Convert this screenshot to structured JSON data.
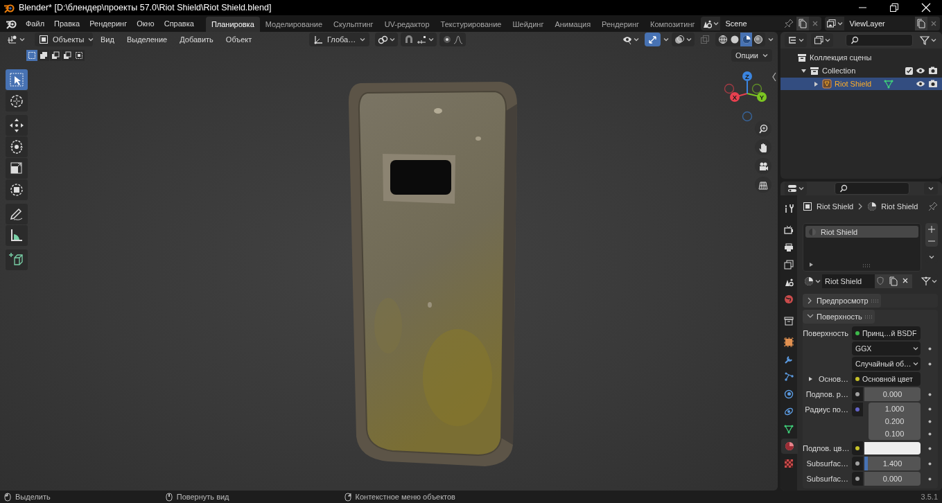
{
  "window": {
    "title": "Blender* [D:\\блендер\\проекты 57.0\\Riot Shield\\Riot Shield.blend]"
  },
  "menu": [
    "Файл",
    "Правка",
    "Рендеринг",
    "Окно",
    "Справка"
  ],
  "workspaces": [
    {
      "label": "Планировка",
      "selected": true
    },
    {
      "label": "Моделирование",
      "selected": false
    },
    {
      "label": "Скульптинг",
      "selected": false
    },
    {
      "label": "UV-редактор",
      "selected": false
    },
    {
      "label": "Текстурирование",
      "selected": false
    },
    {
      "label": "Шейдинг",
      "selected": false
    },
    {
      "label": "Анимация",
      "selected": false
    },
    {
      "label": "Рендеринг",
      "selected": false
    },
    {
      "label": "Композитинг",
      "selected": false
    }
  ],
  "scene": {
    "name": "Scene"
  },
  "view_layer": {
    "name": "ViewLayer"
  },
  "viewport": {
    "mode": "Объекты",
    "menus": [
      "Вид",
      "Выделение",
      "Добавить",
      "Объект"
    ],
    "orientation": "Глоба…",
    "options": "Опции",
    "gizmos_on": true,
    "select_modes": [
      {
        "kind": "set",
        "selected": true
      },
      {
        "kind": "extend",
        "selected": false
      },
      {
        "kind": "subtract",
        "selected": false
      },
      {
        "kind": "difference",
        "selected": false
      },
      {
        "kind": "intersect",
        "selected": false
      }
    ],
    "shading": [
      {
        "kind": "wireframe",
        "selected": false
      },
      {
        "kind": "solid",
        "selected": false
      },
      {
        "kind": "material",
        "selected": true
      },
      {
        "kind": "rendered",
        "selected": false
      }
    ],
    "tools": [
      {
        "kind": "select",
        "selected": true
      },
      {
        "kind": "cursor",
        "selected": false
      },
      {
        "kind": "move",
        "selected": false
      },
      {
        "kind": "rotate",
        "selected": false
      },
      {
        "kind": "scale",
        "selected": false
      },
      {
        "kind": "transform",
        "selected": false
      },
      {
        "kind": "annotate",
        "selected": false
      },
      {
        "kind": "measure",
        "selected": false
      },
      {
        "kind": "add_cube",
        "selected": false
      }
    ],
    "gizmo": {
      "axes": [
        {
          "label": "X",
          "color": "#e8404f"
        },
        {
          "label": "Y",
          "color": "#7cc622"
        },
        {
          "label": "Z",
          "color": "#3b85e0"
        }
      ]
    }
  },
  "outliner": {
    "items": [
      {
        "kind": "scene_collection",
        "label": "Коллекция сцены",
        "children": [
          {
            "kind": "collection",
            "label": "Collection",
            "expanded": true,
            "checked": true,
            "selected": false,
            "children": [
              {
                "kind": "mesh_object",
                "label": "Riot Shield",
                "expanded": false,
                "selected": true
              }
            ]
          }
        ]
      }
    ]
  },
  "properties": {
    "tabs": [
      {
        "kind": "tool",
        "selected": false
      },
      {
        "kind": "render",
        "selected": false
      },
      {
        "kind": "output",
        "selected": false
      },
      {
        "kind": "view_layer",
        "selected": false
      },
      {
        "kind": "scene",
        "selected": false
      },
      {
        "kind": "world",
        "selected": false
      },
      {
        "kind": "collection",
        "selected": false
      },
      {
        "kind": "object",
        "selected": false
      },
      {
        "kind": "modifiers",
        "selected": false
      },
      {
        "kind": "particles",
        "selected": false
      },
      {
        "kind": "physics",
        "selected": false
      },
      {
        "kind": "constraints",
        "selected": false
      },
      {
        "kind": "data",
        "selected": false
      },
      {
        "kind": "material",
        "selected": true
      },
      {
        "kind": "texture",
        "selected": false
      }
    ],
    "breadcrumb": [
      "Riot Shield",
      "Riot Shield"
    ],
    "slots": [
      {
        "label": "Riot Shield",
        "selected": true
      }
    ],
    "material_name": "Riot Shield",
    "panels": [
      {
        "title": "Предпросмотр",
        "expanded": false
      },
      {
        "title": "Поверхность",
        "expanded": true
      }
    ],
    "fields": [
      {
        "kind": "link",
        "label": "Поверхность",
        "socket": {
          "color": "#3cb84a"
        },
        "value": "Принц…й BSDF"
      },
      {
        "kind": "dropdown",
        "value": "GGX"
      },
      {
        "kind": "dropdown",
        "value": "Случайный об…"
      },
      {
        "kind": "link",
        "label": "Основ…",
        "socket": {
          "color": "#c7c229"
        },
        "value": "Основной цвет"
      },
      {
        "kind": "number",
        "label": "Подпов. р…",
        "socket": {
          "color": "#a1a1a1"
        },
        "value": "0.000"
      },
      {
        "kind": "vector",
        "label": "Радиус по…",
        "socket": {
          "color": "#6363c7"
        },
        "values": [
          "1.000",
          "0.200",
          "0.100"
        ]
      },
      {
        "kind": "color",
        "label": "Подпов. цв…",
        "socket": {
          "color": "#c7c229"
        },
        "swatch": {
          "color": "#eeeeee"
        }
      },
      {
        "kind": "slider",
        "label": "Subsurfac…",
        "socket": {
          "color": "#a1a1a1"
        },
        "value": "1.400",
        "level": 0.06
      },
      {
        "kind": "number",
        "label": "Subsurfac…",
        "socket": {
          "color": "#a1a1a1"
        },
        "value": "0.000"
      }
    ]
  },
  "status_bar": {
    "hints": [
      "Выделить",
      "Повернуть вид",
      "Контекстное меню объектов"
    ],
    "version": "3.5.1"
  }
}
